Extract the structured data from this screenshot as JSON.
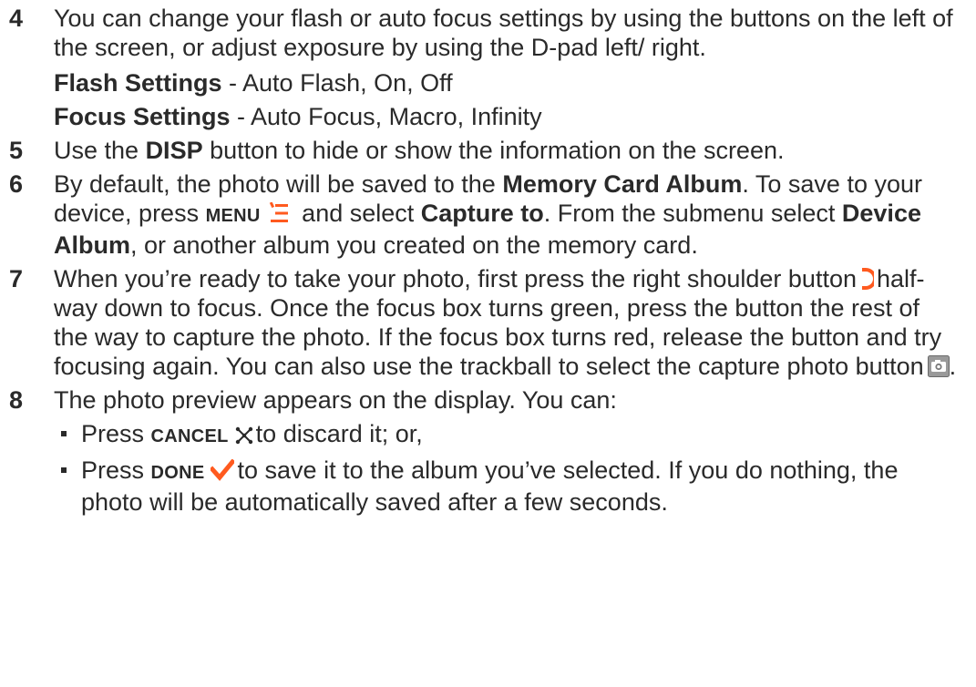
{
  "steps": [
    {
      "num": "4",
      "text": "You can change your flash or auto focus settings by using the buttons on the left of the screen, or adjust exposure by using the D-pad left/ right.",
      "flash": {
        "label": "Flash Settings",
        "text": " - Auto Flash, On, Off"
      },
      "focus": {
        "label": "Focus Settings",
        "text": " - Auto Focus, Macro, Infinity"
      }
    },
    {
      "num": "5",
      "pre": "Use the ",
      "key": "DISP",
      "post": " button to hide or show the information on the screen."
    },
    {
      "num": "6",
      "t1": "By default, the photo will be saved to the ",
      "b1": "Memory Card Album",
      "t2": ". To save to your device, press ",
      "key": "MENU",
      "t3": " and select ",
      "b2": "Capture to",
      "t4": ". From the submenu select ",
      "b3": "Device Album",
      "t5": ", or another album you created on the memory card."
    },
    {
      "num": "7",
      "t1": "When you’re ready to take your photo, first press the right shoulder button",
      "t2": "half-way down to focus. Once the focus box turns green, press the button the rest of the way to capture the photo. If the focus box turns red, release the button and try focusing again. You can also use the trackball to select the capture photo button",
      "t3": "."
    },
    {
      "num": "8",
      "text": "The photo preview appears on the display. You can:",
      "bullets": [
        {
          "pre": "Press ",
          "key": "CANCEL",
          "post": "to discard it; or,"
        },
        {
          "pre": "Press ",
          "key": "DONE",
          "post": "to save it to the album you’ve selected. If you do nothing, the photo will be automatically saved after a few seconds."
        }
      ]
    }
  ],
  "icons": {
    "menu": "menu-lines-icon",
    "shoulder": "right-shoulder-button-icon",
    "camera": "camera-capture-icon",
    "cancel": "cancel-x-icon",
    "done": "done-checkmark-icon"
  },
  "colors": {
    "text": "#2a2a2a",
    "accent": "#ff5a1f"
  }
}
